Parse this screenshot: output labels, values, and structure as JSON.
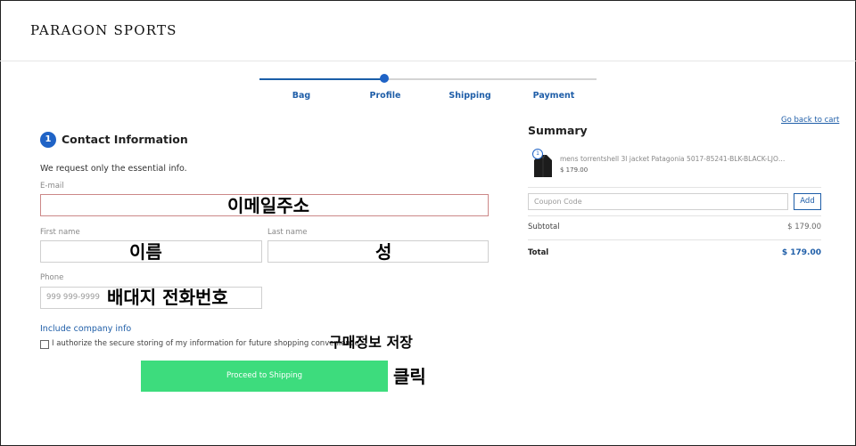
{
  "brand": {
    "logo_text": "PARAGON SPORTS"
  },
  "steps": [
    {
      "label": "Bag",
      "state": "done"
    },
    {
      "label": "Profile",
      "state": "current"
    },
    {
      "label": "Shipping",
      "state": "todo"
    },
    {
      "label": "Payment",
      "state": "todo"
    }
  ],
  "contact": {
    "step_number": "1",
    "title": "Contact Information",
    "intro": "We request only the essential info.",
    "email_label": "E-mail",
    "first_name_label": "First name",
    "last_name_label": "Last name",
    "phone_label": "Phone",
    "phone_placeholder": "999 999-9999",
    "company_link": "Include company info",
    "authorize_text": "I authorize the secure storing of my information for future shopping convenience.",
    "proceed_label": "Proceed to Shipping"
  },
  "annotations": {
    "email": "이메일주소",
    "first_name": "이름",
    "last_name": "성",
    "phone": "배대지 전화번호",
    "save_info": "구매정보 저장",
    "click": "클릭"
  },
  "summary": {
    "back_link": "Go back to cart",
    "title": "Summary",
    "item": {
      "quantity": "1",
      "name": "mens torrentshell 3l jacket Patagonia 5017-85241-BLK-BLACK-LJOUTER...",
      "price": "$ 179.00",
      "image_icon": "jacket-thumbnail"
    },
    "coupon_placeholder": "Coupon Code",
    "add_label": "Add",
    "subtotal_label": "Subtotal",
    "subtotal_value": "$ 179.00",
    "total_label": "Total",
    "total_value": "$ 179.00"
  },
  "colors": {
    "accent": "#1f5ea8",
    "proceed": "#3ddc7d",
    "step_dot": "#1f63c6"
  }
}
